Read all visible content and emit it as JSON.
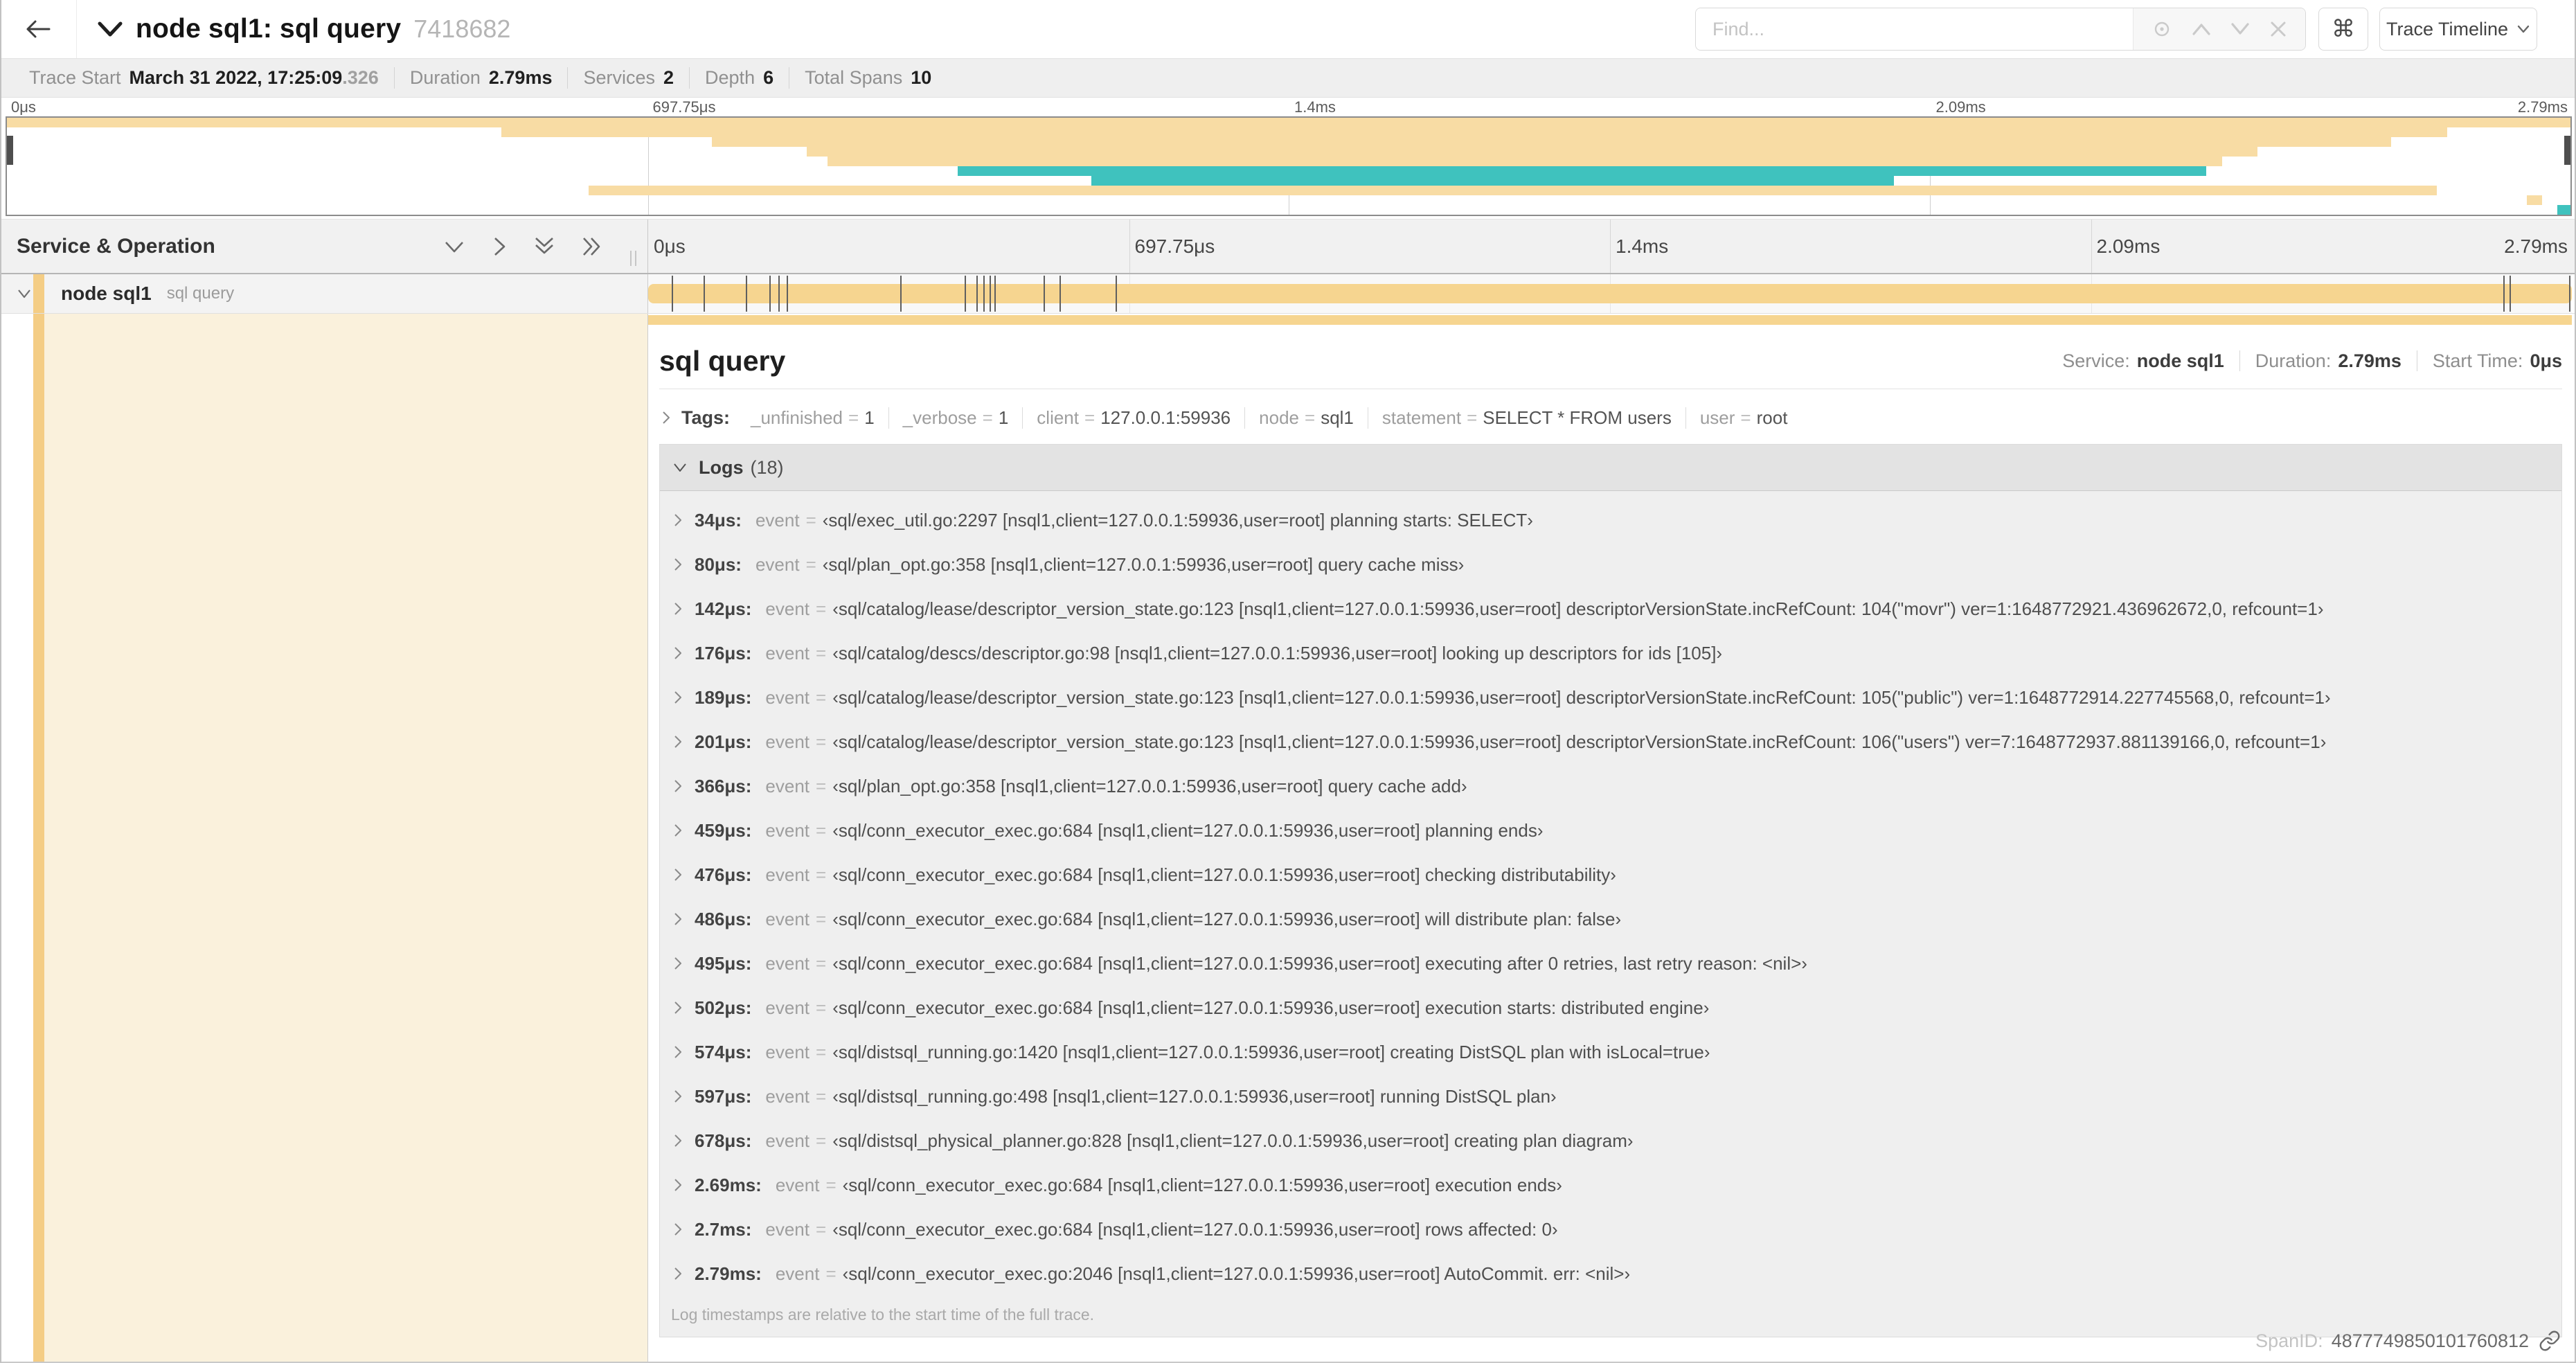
{
  "header": {
    "title": "node sql1: sql query",
    "trace_id": "7418682",
    "find_placeholder": "Find...",
    "shortcut_key": "⌘",
    "view_select": "Trace Timeline"
  },
  "metabar": {
    "items": [
      {
        "label": "Trace Start",
        "value": "March 31 2022, 17:25:09",
        "suffix": ".326"
      },
      {
        "label": "Duration",
        "value": "2.79ms"
      },
      {
        "label": "Services",
        "value": "2"
      },
      {
        "label": "Depth",
        "value": "6"
      },
      {
        "label": "Total Spans",
        "value": "10"
      }
    ]
  },
  "timeline": {
    "left_header": "Service & Operation",
    "ticks": [
      {
        "label": "0μs",
        "pct": 0
      },
      {
        "label": "697.75μs",
        "pct": 25
      },
      {
        "label": "1.4ms",
        "pct": 50
      },
      {
        "label": "2.09ms",
        "pct": 75
      },
      {
        "label": "2.79ms",
        "pct": 100
      }
    ],
    "minimap_spans": [
      {
        "row": 0,
        "start_pct": 0,
        "end_pct": 100,
        "color": "#F8DCA4"
      },
      {
        "row": 1,
        "start_pct": 19.3,
        "end_pct": 95.2,
        "color": "#F8DCA4"
      },
      {
        "row": 2,
        "start_pct": 27.5,
        "end_pct": 93.0,
        "color": "#F8DCA4"
      },
      {
        "row": 3,
        "start_pct": 31.2,
        "end_pct": 87.8,
        "color": "#F8DCA4"
      },
      {
        "row": 4,
        "start_pct": 32.0,
        "end_pct": 86.4,
        "color": "#F8DCA4"
      },
      {
        "row": 5,
        "start_pct": 37.1,
        "end_pct": 85.8,
        "color": "#3FC2BE"
      },
      {
        "row": 6,
        "start_pct": 42.3,
        "end_pct": 73.6,
        "color": "#3FC2BE"
      },
      {
        "row": 7,
        "start_pct": 22.7,
        "end_pct": 94.8,
        "color": "#F8DCA4"
      },
      {
        "row": 8,
        "start_pct": 98.3,
        "end_pct": 98.9,
        "color": "#F8DCA4"
      },
      {
        "row": 9,
        "start_pct": 99.5,
        "end_pct": 100,
        "color": "#3FC2BE"
      }
    ],
    "span_row": {
      "service": "node sql1",
      "operation": "sql query",
      "bar_color": "#F6D590",
      "log_marker_pcts": [
        1.22,
        2.87,
        5.09,
        6.31,
        6.77,
        7.2,
        13.12,
        16.45,
        17.06,
        17.42,
        17.74,
        18.0,
        20.57,
        21.4,
        24.3,
        96.42,
        96.77,
        99.85
      ]
    }
  },
  "detail": {
    "operation": "sql query",
    "service_label": "Service:",
    "service": "node sql1",
    "duration_label": "Duration:",
    "duration": "2.79ms",
    "start_label": "Start Time:",
    "start": "0μs",
    "tags": {
      "label": "Tags:",
      "eq": "=",
      "items": [
        {
          "key": "_unfinished",
          "value": "1"
        },
        {
          "key": "_verbose",
          "value": "1"
        },
        {
          "key": "client",
          "value": "127.0.0.1:59936"
        },
        {
          "key": "node",
          "value": "sql1"
        },
        {
          "key": "statement",
          "value": "SELECT * FROM users"
        },
        {
          "key": "user",
          "value": "root"
        }
      ]
    },
    "logs": {
      "label": "Logs",
      "count": "(18)",
      "event_key": "event",
      "eq": "=",
      "note": "Log timestamps are relative to the start time of the full trace.",
      "rows": [
        {
          "t": "34μs:",
          "v": "‹sql/exec_util.go:2297 [nsql1,client=127.0.0.1:59936,user=root] planning starts: SELECT›"
        },
        {
          "t": "80μs:",
          "v": "‹sql/plan_opt.go:358 [nsql1,client=127.0.0.1:59936,user=root] query cache miss›"
        },
        {
          "t": "142μs:",
          "v": "‹sql/catalog/lease/descriptor_version_state.go:123 [nsql1,client=127.0.0.1:59936,user=root] descriptorVersionState.incRefCount: 104(\"movr\") ver=1:1648772921.436962672,0, refcount=1›"
        },
        {
          "t": "176μs:",
          "v": "‹sql/catalog/descs/descriptor.go:98 [nsql1,client=127.0.0.1:59936,user=root] looking up descriptors for ids [105]›"
        },
        {
          "t": "189μs:",
          "v": "‹sql/catalog/lease/descriptor_version_state.go:123 [nsql1,client=127.0.0.1:59936,user=root] descriptorVersionState.incRefCount: 105(\"public\") ver=1:1648772914.227745568,0, refcount=1›"
        },
        {
          "t": "201μs:",
          "v": "‹sql/catalog/lease/descriptor_version_state.go:123 [nsql1,client=127.0.0.1:59936,user=root] descriptorVersionState.incRefCount: 106(\"users\") ver=7:1648772937.881139166,0, refcount=1›"
        },
        {
          "t": "366μs:",
          "v": "‹sql/plan_opt.go:358 [nsql1,client=127.0.0.1:59936,user=root] query cache add›"
        },
        {
          "t": "459μs:",
          "v": "‹sql/conn_executor_exec.go:684 [nsql1,client=127.0.0.1:59936,user=root] planning ends›"
        },
        {
          "t": "476μs:",
          "v": "‹sql/conn_executor_exec.go:684 [nsql1,client=127.0.0.1:59936,user=root] checking distributability›"
        },
        {
          "t": "486μs:",
          "v": "‹sql/conn_executor_exec.go:684 [nsql1,client=127.0.0.1:59936,user=root] will distribute plan: false›"
        },
        {
          "t": "495μs:",
          "v": "‹sql/conn_executor_exec.go:684 [nsql1,client=127.0.0.1:59936,user=root] executing after 0 retries, last retry reason: <nil>›"
        },
        {
          "t": "502μs:",
          "v": "‹sql/conn_executor_exec.go:684 [nsql1,client=127.0.0.1:59936,user=root] execution starts: distributed engine›"
        },
        {
          "t": "574μs:",
          "v": "‹sql/distsql_running.go:1420 [nsql1,client=127.0.0.1:59936,user=root] creating DistSQL plan with isLocal=true›"
        },
        {
          "t": "597μs:",
          "v": "‹sql/distsql_running.go:498 [nsql1,client=127.0.0.1:59936,user=root] running DistSQL plan›"
        },
        {
          "t": "678μs:",
          "v": "‹sql/distsql_physical_planner.go:828 [nsql1,client=127.0.0.1:59936,user=root] creating plan diagram›"
        },
        {
          "t": "2.69ms:",
          "v": "‹sql/conn_executor_exec.go:684 [nsql1,client=127.0.0.1:59936,user=root] execution ends›"
        },
        {
          "t": "2.7ms:",
          "v": "‹sql/conn_executor_exec.go:684 [nsql1,client=127.0.0.1:59936,user=root] rows affected: 0›"
        },
        {
          "t": "2.79ms:",
          "v": "‹sql/conn_executor_exec.go:2046 [nsql1,client=127.0.0.1:59936,user=root] AutoCommit. err: <nil>›"
        }
      ]
    },
    "span_id_label": "SpanID:",
    "span_id": "4877749850101760812"
  }
}
